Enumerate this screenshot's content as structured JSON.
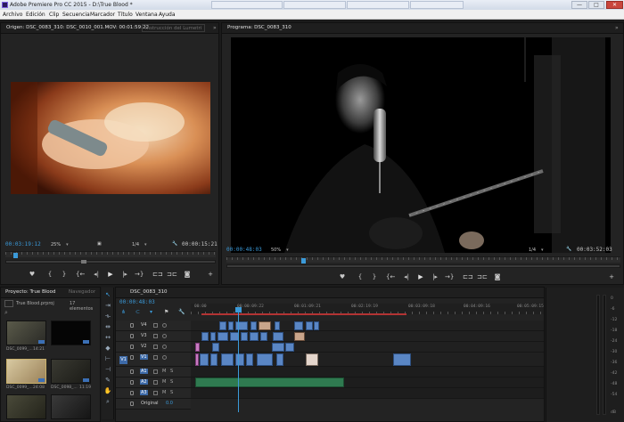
{
  "window": {
    "title": "Adobe Premiere Pro CC 2015 - D:\\True Blood *",
    "minimize": "—",
    "maximize": "□",
    "close": "✕"
  },
  "menu": [
    "Archivo",
    "Edición",
    "Clip",
    "Secuencia",
    "Marcador",
    "Título",
    "Ventana",
    "Ayuda"
  ],
  "source_monitor": {
    "tab_label": "Origen: DSC_0083_310: DSC_0010_001.MOV: 00:01:59:22",
    "secondary_tab": "Instrucción del Lumetri",
    "timecode_left": "00:03:19:12",
    "zoom": "25%",
    "resolution": "1/4",
    "timecode_right": "00:00:15:21"
  },
  "program_monitor": {
    "tab_label": "Programa: DSC_0083_310",
    "timecode_left": "00:00:48:03",
    "zoom": "50%",
    "resolution": "1/4",
    "timecode_right": "00:03:52:03"
  },
  "transport_icons": [
    "marker-icon",
    "mark-in-icon",
    "mark-out-icon",
    "go-to-in-icon",
    "step-back-icon",
    "play-icon",
    "step-forward-icon",
    "go-to-out-icon",
    "insert-icon",
    "overwrite-icon",
    "export-frame-icon",
    "add-icon"
  ],
  "transport_glyphs": {
    "marker": "♥",
    "in": "{",
    "out": "}",
    "go_in": "{←",
    "step_back": "◂|",
    "play": "▶",
    "step_fwd": "|▸",
    "go_out": "→}",
    "insert": "⊏⊐",
    "overwrite": "⊐⊏",
    "camera": "◙",
    "add": "+"
  },
  "project": {
    "tab_label": "Proyecto: True Blood",
    "secondary_tab": "Navegador",
    "file": "True Blood.prproj",
    "count": "17 elementos",
    "items": [
      {
        "caption": "DSC_0099_...",
        "duration": "14:21"
      },
      {
        "caption": "",
        "duration": ""
      },
      {
        "caption": "DSC_0099_...",
        "duration": "24:08"
      },
      {
        "caption": "DSC_0098_...",
        "duration": "11:19"
      },
      {
        "caption": "",
        "duration": ""
      },
      {
        "caption": "",
        "duration": ""
      }
    ]
  },
  "timeline": {
    "tab_label": "DSC_0083_310",
    "timecode": "00:00:48:03",
    "ruler": [
      "00:00",
      "00:00:09:22",
      "00:01:09:21",
      "00:02:19:19",
      "00:03:09:18",
      "00:04:09:16",
      "00:05:09:15"
    ],
    "tracks": [
      {
        "name": "V4",
        "type": "video"
      },
      {
        "name": "V3",
        "type": "video"
      },
      {
        "name": "V2",
        "type": "video"
      },
      {
        "name": "V1",
        "type": "video",
        "source": "V1"
      },
      {
        "name": "A1",
        "type": "audio"
      },
      {
        "name": "A2",
        "type": "audio"
      },
      {
        "name": "A3",
        "type": "audio"
      }
    ],
    "audio_labels": {
      "mute": "M",
      "solo": "S"
    },
    "master_label": "Original",
    "master_value": "0.0"
  },
  "meter": {
    "scale": [
      "0",
      "-6",
      "-12",
      "-18",
      "-24",
      "-30",
      "-36",
      "-42",
      "-48",
      "-54",
      "dB"
    ]
  }
}
